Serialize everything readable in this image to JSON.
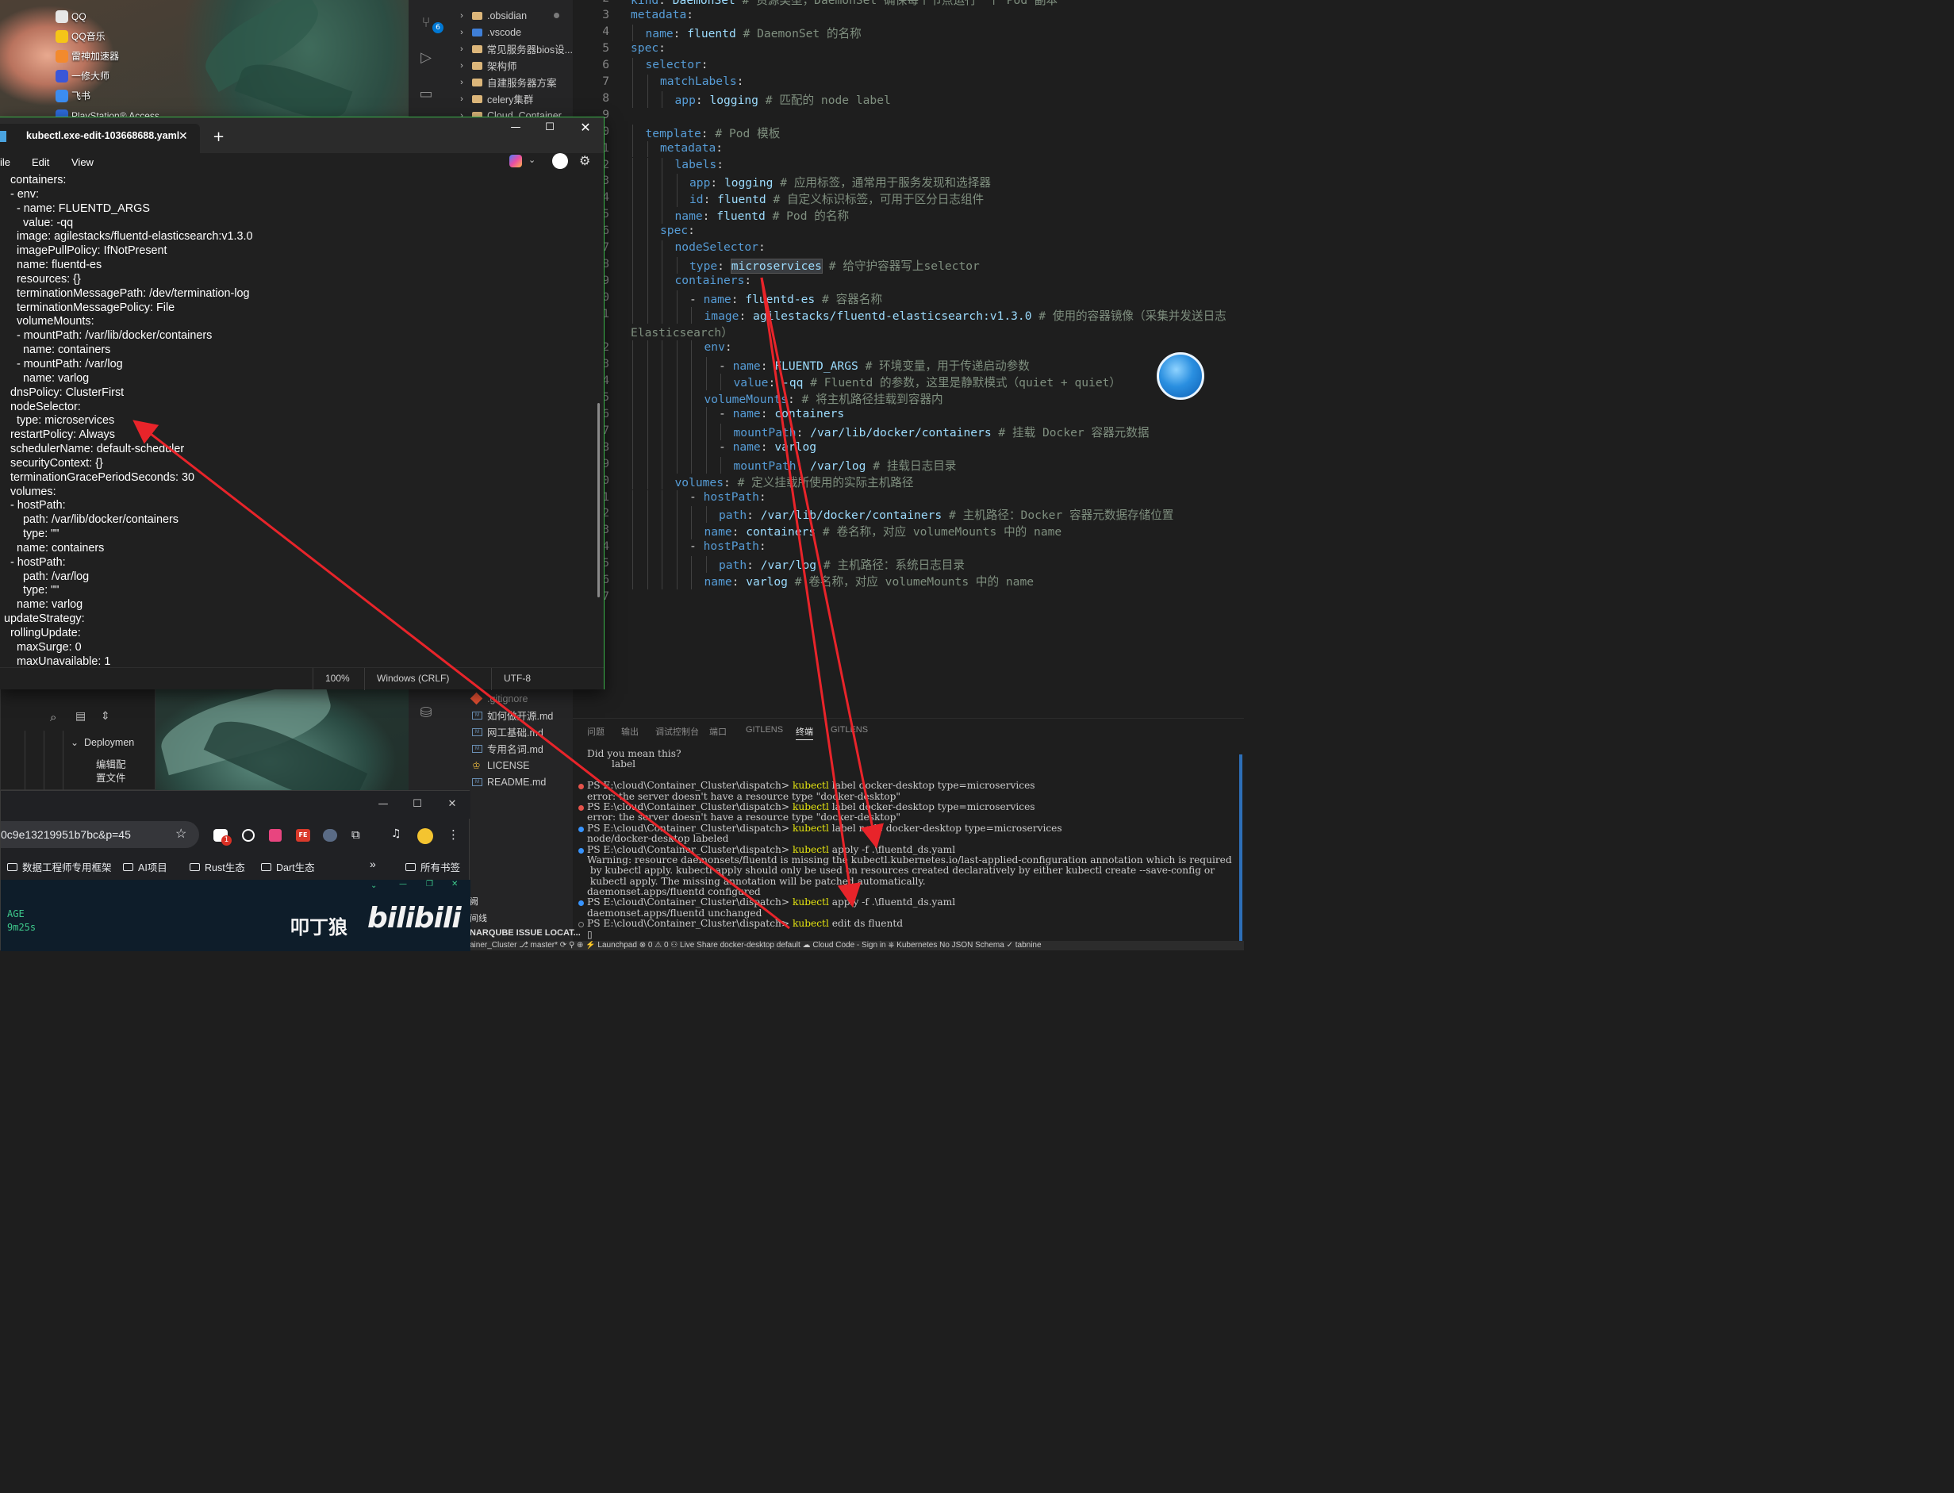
{
  "desktop": {
    "icons": [
      {
        "label": "QQ",
        "icon": "qq-icon",
        "color": "#e6e6e6"
      },
      {
        "label": "QQ音乐",
        "icon": "qq-music-icon",
        "color": "#f5c518"
      },
      {
        "label": "雷神加速器",
        "icon": "thunder-accelerator-icon",
        "color": "#f28a2e"
      },
      {
        "label": "一修大师",
        "icon": "repair-master-icon",
        "color": "#3a57d8"
      },
      {
        "label": "飞书",
        "icon": "feishu-icon",
        "color": "#3c8cf0"
      },
      {
        "label": "PlayStation® Access...",
        "icon": "playstation-icon",
        "color": "#2d6cdf"
      }
    ]
  },
  "vscode": {
    "activity_badge": "6",
    "explorer_top": [
      {
        "name": ".obsidian",
        "type": "folder",
        "modified": true
      },
      {
        "name": ".vscode",
        "type": "folder"
      },
      {
        "name": "常见服务器bios设...",
        "type": "folder"
      },
      {
        "name": "架构师",
        "type": "folder"
      },
      {
        "name": "自建服务器方案",
        "type": "folder"
      },
      {
        "name": "celery集群",
        "type": "folder"
      },
      {
        "name": "Cloud_Container...",
        "type": "folder"
      }
    ],
    "explorer_bottom": [
      {
        "name": ".gitignore",
        "type": "git"
      },
      {
        "name": "如何做开源.md",
        "type": "md"
      },
      {
        "name": "网工基础.md",
        "type": "md"
      },
      {
        "name": "专用名词.md",
        "type": "md"
      },
      {
        "name": "LICENSE",
        "type": "license"
      },
      {
        "name": "README.md",
        "type": "md"
      }
    ],
    "editor": {
      "line_numbers": [
        "2",
        "3",
        "4",
        "5",
        "6",
        "7",
        "8",
        "9",
        "0",
        "1",
        "2",
        "3",
        "4",
        "5",
        "6",
        "7",
        "8",
        "9",
        "0",
        "1",
        "",
        "2",
        "3",
        "4",
        "5",
        "6",
        "7",
        "8",
        "9",
        "0",
        "1",
        "2",
        "3",
        "4",
        "5",
        "6",
        "7"
      ],
      "lines": [
        {
          "indent": 0,
          "key": "kind",
          "value": "DaemonSet",
          "comment": "# 资源类型，DaemonSet 确保每个节点运行一个 Pod 副本"
        },
        {
          "indent": 0,
          "key": "metadata",
          "value": "",
          "comment": ""
        },
        {
          "indent": 1,
          "key": "name",
          "value": "fluentd",
          "comment": "# DaemonSet 的名称"
        },
        {
          "indent": 0,
          "key": "spec",
          "value": "",
          "comment": ""
        },
        {
          "indent": 1,
          "key": "selector",
          "value": "",
          "comment": ""
        },
        {
          "indent": 2,
          "key": "matchLabels",
          "value": "",
          "comment": ""
        },
        {
          "indent": 3,
          "key": "app",
          "value": "logging",
          "comment": "# 匹配的 node label"
        },
        {
          "indent": 0,
          "key": "",
          "value": "",
          "comment": ""
        },
        {
          "indent": 1,
          "key": "template",
          "value": "",
          "comment": "# Pod 模板"
        },
        {
          "indent": 2,
          "key": "metadata",
          "value": "",
          "comment": ""
        },
        {
          "indent": 3,
          "key": "labels",
          "value": "",
          "comment": ""
        },
        {
          "indent": 4,
          "key": "app",
          "value": "logging",
          "comment": "# 应用标签，通常用于服务发现和选择器"
        },
        {
          "indent": 4,
          "key": "id",
          "value": "fluentd",
          "comment": "# 自定义标识标签，可用于区分日志组件"
        },
        {
          "indent": 3,
          "key": "name",
          "value": "fluentd",
          "comment": "# Pod 的名称"
        },
        {
          "indent": 2,
          "key": "spec",
          "value": "",
          "comment": ""
        },
        {
          "indent": 3,
          "key": "nodeSelector",
          "value": "",
          "comment": ""
        },
        {
          "indent": 4,
          "key": "type",
          "value": "microservices",
          "comment": "# 给守护容器写上selector",
          "highlight": true
        },
        {
          "indent": 3,
          "key": "containers",
          "value": "",
          "comment": ""
        },
        {
          "indent": 4,
          "key": "- name",
          "value": "fluentd-es",
          "comment": "# 容器名称"
        },
        {
          "indent": 5,
          "key": "image",
          "value": "agilestacks/fluentd-elasticsearch:v1.3.0",
          "comment": "# 使用的容器镜像（采集并发送日志"
        },
        {
          "indent": -1,
          "key": "",
          "value": "",
          "comment": "Elasticsearch）"
        },
        {
          "indent": 5,
          "key": "env",
          "value": "",
          "comment": ""
        },
        {
          "indent": 6,
          "key": "- name",
          "value": "FLUENTD_ARGS",
          "comment": "# 环境变量，用于传递启动参数"
        },
        {
          "indent": 7,
          "key": "value",
          "value": "-qq",
          "comment": "# Fluentd 的参数，这里是静默模式（quiet + quiet）"
        },
        {
          "indent": 5,
          "key": "volumeMounts",
          "value": "",
          "comment": "# 将主机路径挂载到容器内"
        },
        {
          "indent": 6,
          "key": "- name",
          "value": "containers",
          "comment": ""
        },
        {
          "indent": 7,
          "key": "mountPath",
          "value": "/var/lib/docker/containers",
          "comment": "# 挂载 Docker 容器元数据"
        },
        {
          "indent": 6,
          "key": "- name",
          "value": "varlog",
          "comment": ""
        },
        {
          "indent": 7,
          "key": "mountPath",
          "value": "/var/log",
          "comment": "# 挂载日志目录"
        },
        {
          "indent": 3,
          "key": "volumes",
          "value": "",
          "comment": "# 定义挂载所使用的实际主机路径"
        },
        {
          "indent": 4,
          "key": "- hostPath",
          "value": "",
          "comment": ""
        },
        {
          "indent": 6,
          "key": "path",
          "value": "/var/lib/docker/containers",
          "comment": "# 主机路径：Docker 容器元数据存储位置"
        },
        {
          "indent": 5,
          "key": "name",
          "value": "containers",
          "comment": "# 卷名称，对应 volumeMounts 中的 name"
        },
        {
          "indent": 4,
          "key": "- hostPath",
          "value": "",
          "comment": ""
        },
        {
          "indent": 6,
          "key": "path",
          "value": "/var/log",
          "comment": "# 主机路径：系统日志目录"
        },
        {
          "indent": 5,
          "key": "name",
          "value": "varlog",
          "comment": "# 卷名称，对应 volumeMounts 中的 name"
        },
        {
          "indent": 0,
          "key": "",
          "value": "",
          "comment": ""
        }
      ]
    },
    "panel_tabs": [
      "问题",
      "输出",
      "调试控制台",
      "端口",
      "GITLENS",
      "终端",
      "GITLENS"
    ],
    "active_panel_tab": "终端",
    "terminal_lines": [
      {
        "text": "Did you mean this?",
        "dot": ""
      },
      {
        "text": "        label",
        "dot": ""
      },
      {
        "text": "",
        "dot": ""
      },
      {
        "text": "PS E:\\cloud\\Container_Cluster\\dispatch> kubectl label docker-desktop type=microservices",
        "dot": "error"
      },
      {
        "text": "error: the server doesn't have a resource type \"docker-desktop\"",
        "dot": ""
      },
      {
        "text": "PS E:\\cloud\\Container_Cluster\\dispatch> kubectl label docker-desktop type=microservices",
        "dot": "error"
      },
      {
        "text": "error: the server doesn't have a resource type \"docker-desktop\"",
        "dot": ""
      },
      {
        "text": "PS E:\\cloud\\Container_Cluster\\dispatch> kubectl label node docker-desktop type=microservices",
        "dot": "ok"
      },
      {
        "text": "node/docker-desktop labeled",
        "dot": ""
      },
      {
        "text": "PS E:\\cloud\\Container_Cluster\\dispatch> kubectl apply -f .\\fluentd_ds.yaml",
        "dot": "ok"
      },
      {
        "text": "Warning: resource daemonsets/fluentd is missing the kubectl.kubernetes.io/last-applied-configuration annotation which is required",
        "dot": ""
      },
      {
        "text": " by kubectl apply. kubectl apply should only be used on resources created declaratively by either kubectl create --save-config or",
        "dot": ""
      },
      {
        "text": " kubectl apply. The missing annotation will be patched automatically.",
        "dot": ""
      },
      {
        "text": "daemonset.apps/fluentd configured",
        "dot": ""
      },
      {
        "text": "PS E:\\cloud\\Container_Cluster\\dispatch> kubectl apply -f .\\fluentd_ds.yaml",
        "dot": "ok"
      },
      {
        "text": "daemonset.apps/fluentd unchanged",
        "dot": ""
      },
      {
        "text": "PS E:\\cloud\\Container_Cluster\\dispatch> kubectl edit ds fluentd",
        "dot": "idle"
      },
      {
        "text": "▯",
        "dot": ""
      }
    ],
    "statusbar": "ainer_Cluster  ⎇ master*   ⟳   ⚲  ⊕    ⚡ Launchpad    ⊗ 0 ⚠ 0    ⚇ Live Share    docker-desktop   default    ☁ Cloud Code - Sign in    ⎈ Kubernetes    No JSON Schema   ✓ tabnine"
  },
  "notepad": {
    "tab_title": "kubectl.exe-edit-103668688.yaml",
    "menu": [
      "ile",
      "Edit",
      "View"
    ],
    "lines": [
      "  containers:",
      "  - env:",
      "    - name: FLUENTD_ARGS",
      "      value: -qq",
      "    image: agilestacks/fluentd-elasticsearch:v1.3.0",
      "    imagePullPolicy: IfNotPresent",
      "    name: fluentd-es",
      "    resources: {}",
      "    terminationMessagePath: /dev/termination-log",
      "    terminationMessagePolicy: File",
      "    volumeMounts:",
      "    - mountPath: /var/lib/docker/containers",
      "      name: containers",
      "    - mountPath: /var/log",
      "      name: varlog",
      "  dnsPolicy: ClusterFirst",
      "  nodeSelector:",
      "    type: microservices",
      "  restartPolicy: Always",
      "  schedulerName: default-scheduler",
      "  securityContext: {}",
      "  terminationGracePeriodSeconds: 30",
      "  volumes:",
      "  - hostPath:",
      "      path: /var/lib/docker/containers",
      "      type: \"\"",
      "    name: containers",
      "  - hostPath:",
      "      path: /var/log",
      "      type: \"\"",
      "    name: varlog",
      "updateStrategy:",
      "  rollingUpdate:",
      "    maxSurge: 0",
      "    maxUnavailable: 1"
    ],
    "status": {
      "zoom": "100%",
      "line_ending": "Windows (CRLF)",
      "encoding": "UTF-8"
    }
  },
  "smallwin": {
    "tree_label": "Deploymen",
    "item_label_1": "编辑配",
    "item_label_2": "置文件"
  },
  "browser": {
    "url": "0c9e13219951b7bc&p=45",
    "extension_badge": "1",
    "bookmarks": [
      "数据工程师专用框架",
      "AI项目",
      "Rust生态",
      "Dart生态"
    ],
    "all_bookmarks": "所有书签",
    "age_label": "AGE",
    "age_value": "9m25s",
    "watermark": "叩丁狼",
    "bili": "bilibili"
  },
  "side_labels": {
    "a": "阙",
    "b": "间线",
    "c": "NARQUBE ISSUE LOCAT..."
  },
  "colors": {
    "accent_green": "#3bb34a",
    "arrow_red": "#e8242a",
    "yaml_key": "#569cd6",
    "yaml_value": "#9cdcfe"
  }
}
